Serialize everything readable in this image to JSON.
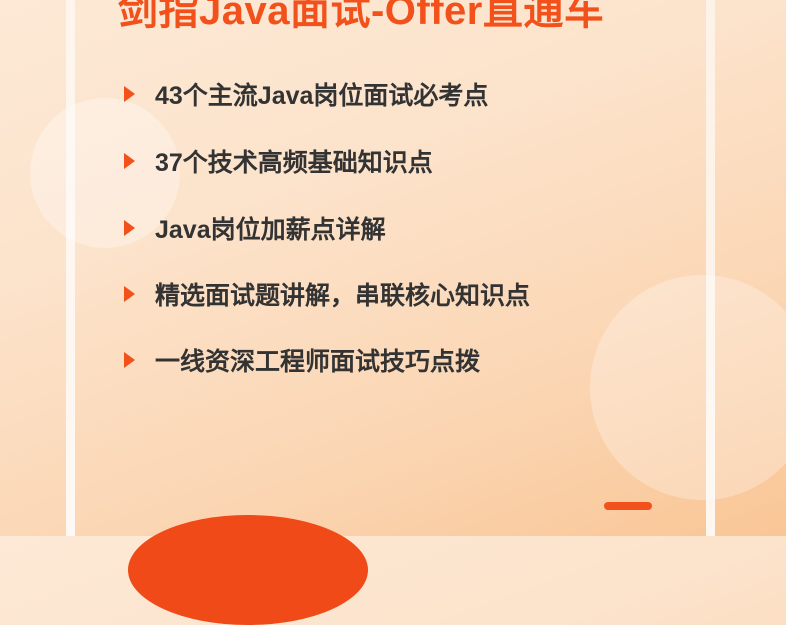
{
  "headline": "剑指Java面试-Offer直通车",
  "items": [
    "43个主流Java岗位面试必考点",
    "37个技术高频基础知识点",
    "Java岗位加薪点详解",
    "精选面试题讲解，串联核心知识点",
    "一线资深工程师面试技巧点拨"
  ],
  "colors": {
    "accent": "#f2511b",
    "text": "#333333",
    "background": "#fce3cb"
  },
  "icons": {
    "bullet": "arrow-right-icon"
  }
}
